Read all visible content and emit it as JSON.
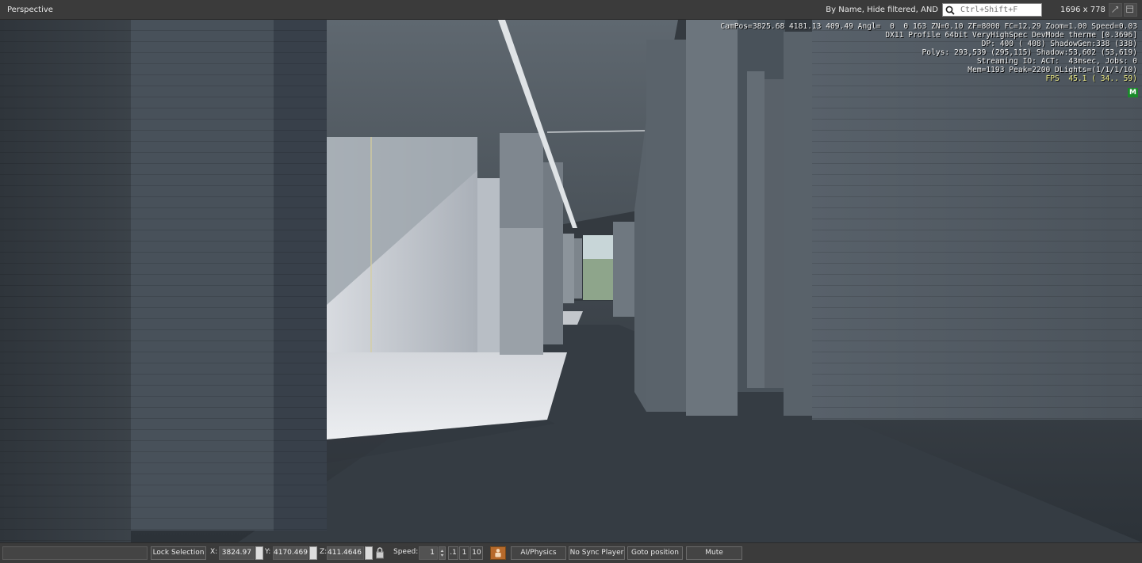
{
  "topbar": {
    "viewport_title": "Perspective",
    "filter_label": "By Name, Hide filtered, AND",
    "search_placeholder": "Ctrl+Shift+F",
    "resolution": "1696 x 778"
  },
  "overlay": {
    "lines": [
      "CamPos=3825.68 4181.13 409.49 Angl=  0  0 163 ZN=0.10 ZF=8000 FC=12.29 Zoom=1.00 Speed=0.03",
      "DX11 Profile 64bit VeryHighSpec DevMode therme [0.3696]",
      "DP: 400 ( 408) ShadowGen:338 (338)",
      "Polys: 293,539 (295,115) Shadow:53,602 (53,619)",
      "Streaming IO: ACT:  43msec, Jobs: 0",
      "Mem=1193 Peak=2200 DLights=(1/1/1/10)"
    ],
    "fps": "FPS  45.1 ( 34.. 59)",
    "badge": "M"
  },
  "bottombar": {
    "status": "",
    "lock_selection": "Lock Selection",
    "x_label": "X:",
    "x_value": "3824.97",
    "y_label": "Y:",
    "y_value": "4170.469",
    "z_label": "Z:",
    "z_value": "411.4646",
    "speed_label": "Speed:",
    "speed_value": "1",
    "speed_presets": [
      ".1",
      "1",
      "10"
    ],
    "ai_physics": "AI/Physics",
    "no_sync": "No Sync Player",
    "goto": "Goto position",
    "mute": "Mute"
  },
  "colors": {
    "bar_bg": "#3b3b3b",
    "fps_color": "#f0ef8a",
    "badge_green": "#1a8a2a",
    "person_button": "#b76a2b"
  },
  "icons": {
    "search": "search-icon",
    "lock": "lock-icon",
    "person": "person-icon"
  }
}
